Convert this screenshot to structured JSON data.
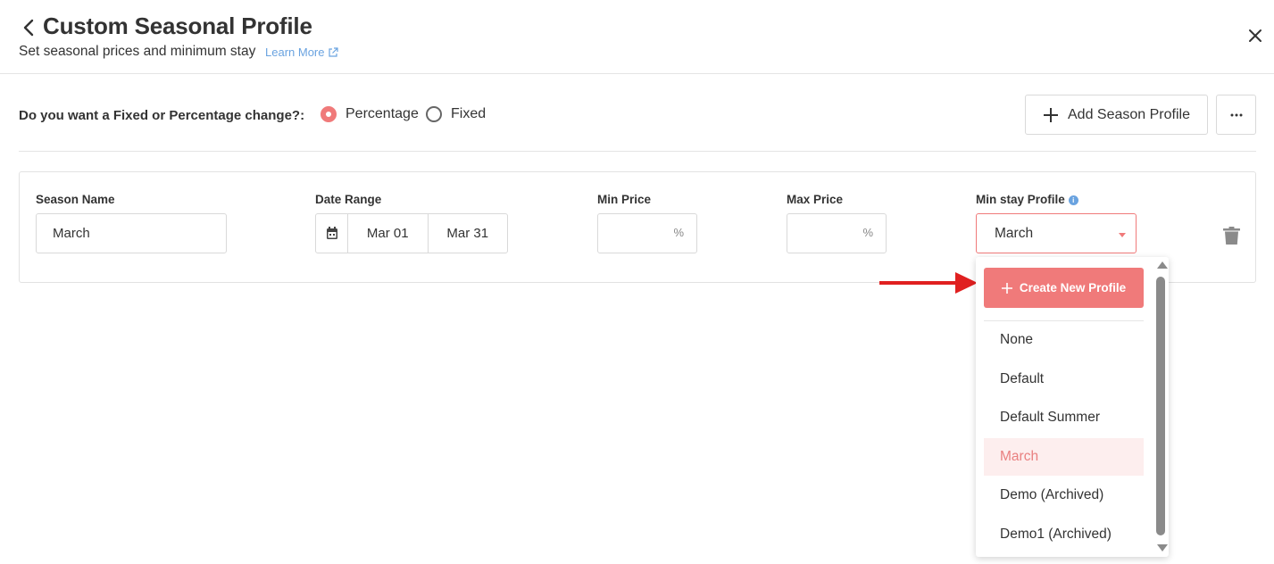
{
  "header": {
    "title": "Custom Seasonal Profile",
    "subtitle": "Set seasonal prices and minimum stay",
    "learn_more": "Learn More"
  },
  "change_type": {
    "question": "Do you want a Fixed or Percentage change?:",
    "options": [
      {
        "label": "Percentage",
        "selected": true
      },
      {
        "label": "Fixed",
        "selected": false
      }
    ]
  },
  "toolbar": {
    "add_season_label": "Add Season Profile",
    "more_label": "···"
  },
  "season": {
    "name_label": "Season Name",
    "name_value": "March",
    "date_label": "Date Range",
    "date_start": "Mar 01",
    "date_end": "Mar 31",
    "min_price_label": "Min Price",
    "min_price_value": "",
    "max_price_label": "Max Price",
    "max_price_value": "",
    "unit": "%",
    "min_stay_label": "Min stay Profile",
    "min_stay_value": "March"
  },
  "dropdown": {
    "create_label": "Create New Profile",
    "items": [
      {
        "label": "None",
        "active": false
      },
      {
        "label": "Default",
        "active": false
      },
      {
        "label": "Default Summer",
        "active": false
      },
      {
        "label": "March",
        "active": true
      },
      {
        "label": "Demo (Archived)",
        "active": false
      },
      {
        "label": "Demo1 (Archived)",
        "active": false
      }
    ]
  },
  "colors": {
    "accent": "#f07a7a",
    "link": "#6aa3e0",
    "annotation_arrow": "#e02020",
    "selected_item_bg": "#fdeeee"
  },
  "icons": {
    "back": "chevron-left-icon",
    "close": "close-icon",
    "external_link": "external-link-icon",
    "add": "plus-icon",
    "more": "ellipsis-icon",
    "calendar": "calendar-icon",
    "info": "info-icon",
    "delete": "trash-icon"
  }
}
